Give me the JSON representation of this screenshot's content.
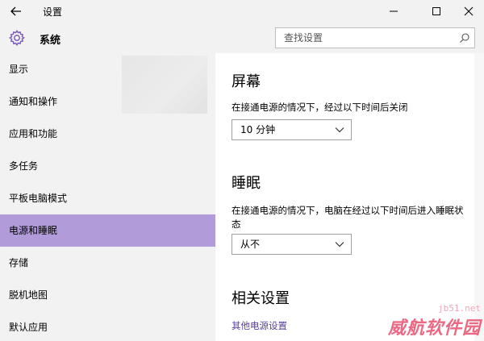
{
  "window": {
    "title": "设置",
    "controls": [
      "minimize",
      "maximize",
      "close"
    ]
  },
  "header": {
    "title": "系统",
    "icon": "gear-icon"
  },
  "search": {
    "placeholder": "查找设置"
  },
  "sidebar": {
    "items": [
      {
        "label": "显示",
        "selected": false
      },
      {
        "label": "通知和操作",
        "selected": false
      },
      {
        "label": "应用和功能",
        "selected": false
      },
      {
        "label": "多任务",
        "selected": false
      },
      {
        "label": "平板电脑模式",
        "selected": false
      },
      {
        "label": "电源和睡眠",
        "selected": true
      },
      {
        "label": "存储",
        "selected": false
      },
      {
        "label": "脱机地图",
        "selected": false
      },
      {
        "label": "默认应用",
        "selected": false
      }
    ]
  },
  "main": {
    "screen": {
      "title": "屏幕",
      "description": "在接通电源的情况下，经过以下时间后关闭",
      "value": "10 分钟"
    },
    "sleep": {
      "title": "睡眠",
      "description": "在接通电源的情况下，电脑在经过以下时间后进入睡眠状态",
      "value": "从不"
    },
    "related": {
      "title": "相关设置",
      "link": "其他电源设置"
    }
  },
  "watermark": {
    "url": "jb51.net",
    "text": "威航软件园"
  },
  "colors": {
    "accent": "#b19cd9",
    "link": "#5a3fa0",
    "chrome": "#f2f2f2"
  }
}
